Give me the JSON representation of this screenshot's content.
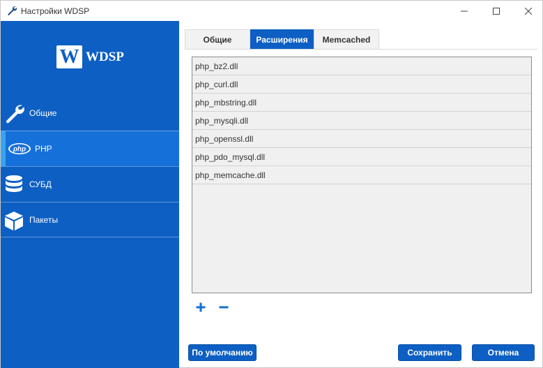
{
  "window": {
    "title": "Настройки WDSP",
    "icon": "wrench-icon"
  },
  "sidebar": {
    "logo": {
      "letter": "W",
      "text": "WDSP"
    },
    "items": [
      {
        "label": "Общие",
        "icon": "wrench-icon"
      },
      {
        "label": "PHP",
        "icon": "php-icon",
        "icon_text": "php",
        "active": true
      },
      {
        "label": "СУБД",
        "icon": "database-icon"
      },
      {
        "label": "Пакеты",
        "icon": "package-icon"
      }
    ]
  },
  "tabs": [
    {
      "label": "Общие"
    },
    {
      "label": "Расширения",
      "active": true
    },
    {
      "label": "Memcached"
    }
  ],
  "extensions": [
    "php_bz2.dll",
    "php_curl.dll",
    "php_mbstring.dll",
    "php_mysqli.dll",
    "php_openssl.dll",
    "php_pdo_mysql.dll",
    "php_memcache.dll"
  ],
  "actions": {
    "add_icon": "plus-icon",
    "remove_icon": "minus-icon"
  },
  "buttons": {
    "default": "По умолчанию",
    "save": "Сохранить",
    "cancel": "Отмена"
  },
  "colors": {
    "accent": "#0d5fc3",
    "active_item": "#1670da",
    "active_marker": "#37a4ee"
  }
}
